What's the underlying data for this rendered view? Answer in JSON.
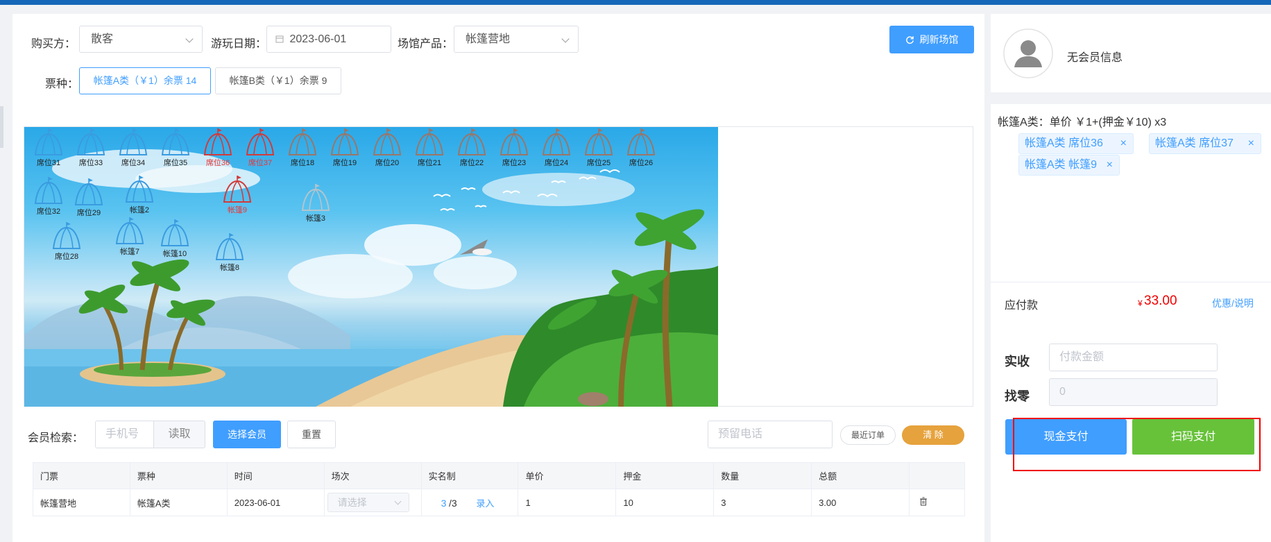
{
  "form": {
    "buyer_label": "购买方：",
    "buyer_value": "散客",
    "date_label": "游玩日期：",
    "date_value": "2023-06-01",
    "product_label": "场馆产品：",
    "product_value": "帐篷营地",
    "refresh_label": "刷新场馆",
    "ticket_type_label": "票种：",
    "ticket_types": [
      {
        "label": "帐篷A类（￥1）余票 14",
        "active": true
      },
      {
        "label": "帐篷B类（￥1）余票 9",
        "active": false
      }
    ]
  },
  "seats": [
    {
      "label": "席位31",
      "status": "available"
    },
    {
      "label": "席位33",
      "status": "available"
    },
    {
      "label": "席位34",
      "status": "available"
    },
    {
      "label": "席位35",
      "status": "available"
    },
    {
      "label": "席位36",
      "status": "selected"
    },
    {
      "label": "席位37",
      "status": "selected"
    },
    {
      "label": "席位18",
      "status": "occupied"
    },
    {
      "label": "席位19",
      "status": "occupied"
    },
    {
      "label": "席位20",
      "status": "occupied"
    },
    {
      "label": "席位21",
      "status": "occupied"
    },
    {
      "label": "席位22",
      "status": "occupied"
    },
    {
      "label": "席位23",
      "status": "occupied"
    },
    {
      "label": "席位24",
      "status": "occupied"
    },
    {
      "label": "席位25",
      "status": "occupied"
    },
    {
      "label": "席位26",
      "status": "occupied"
    },
    {
      "label": "席位32",
      "status": "available"
    },
    {
      "label": "席位29",
      "status": "available"
    },
    {
      "label": "帐篷2",
      "status": "available"
    },
    {
      "label": "帐篷9",
      "status": "selected"
    },
    {
      "label": "帐篷3",
      "status": "disabled"
    },
    {
      "label": "席位28",
      "status": "available"
    },
    {
      "label": "帐篷7",
      "status": "available"
    },
    {
      "label": "帐篷10",
      "status": "available"
    },
    {
      "label": "帐篷8",
      "status": "available"
    }
  ],
  "member": {
    "search_label": "会员检索：",
    "phone_placeholder": "手机号",
    "read_label": "读取",
    "select_label": "选择会员",
    "reset_label": "重置",
    "reserved_phone_placeholder": "预留电话",
    "recent_orders_label": "最近订单",
    "clear_label": "清 除"
  },
  "table": {
    "headers": [
      "门票",
      "票种",
      "时间",
      "场次",
      "实名制",
      "单价",
      "押金",
      "数量",
      "总额",
      ""
    ],
    "row": {
      "ticket": "帐篷营地",
      "type": "帐篷A类",
      "time": "2023-06-01",
      "session_placeholder": "请选择",
      "realname_count": "3",
      "realname_total": "/3",
      "realname_action": "录入",
      "price": "1",
      "deposit": "10",
      "quantity": "3",
      "total": "3.00"
    }
  },
  "side": {
    "member_info": "无会员信息",
    "summary": "帐篷A类：单价 ￥1+(押金￥10) x3",
    "selected_tags": [
      "帐篷A类 席位36",
      "帐篷A类 席位37",
      "帐篷A类 帐篷9"
    ],
    "payable_label": "应付款",
    "currency": "¥",
    "payable_amount": "33.00",
    "discount_link": "优惠/说明",
    "received_label": "实收",
    "received_placeholder": "付款金额",
    "change_label": "找零",
    "change_value": "0",
    "cash_pay_label": "现金支付",
    "scan_pay_label": "扫码支付"
  },
  "colors": {
    "primary": "#409eff",
    "orange": "#e6a23c",
    "green": "#67c23a",
    "red": "#f00000",
    "header_bar": "#1566b8",
    "seat_available": "#3a9be0",
    "seat_selected": "#d23a3a",
    "seat_occupied": "#9a7668",
    "seat_disabled": "#b5c4cc"
  }
}
